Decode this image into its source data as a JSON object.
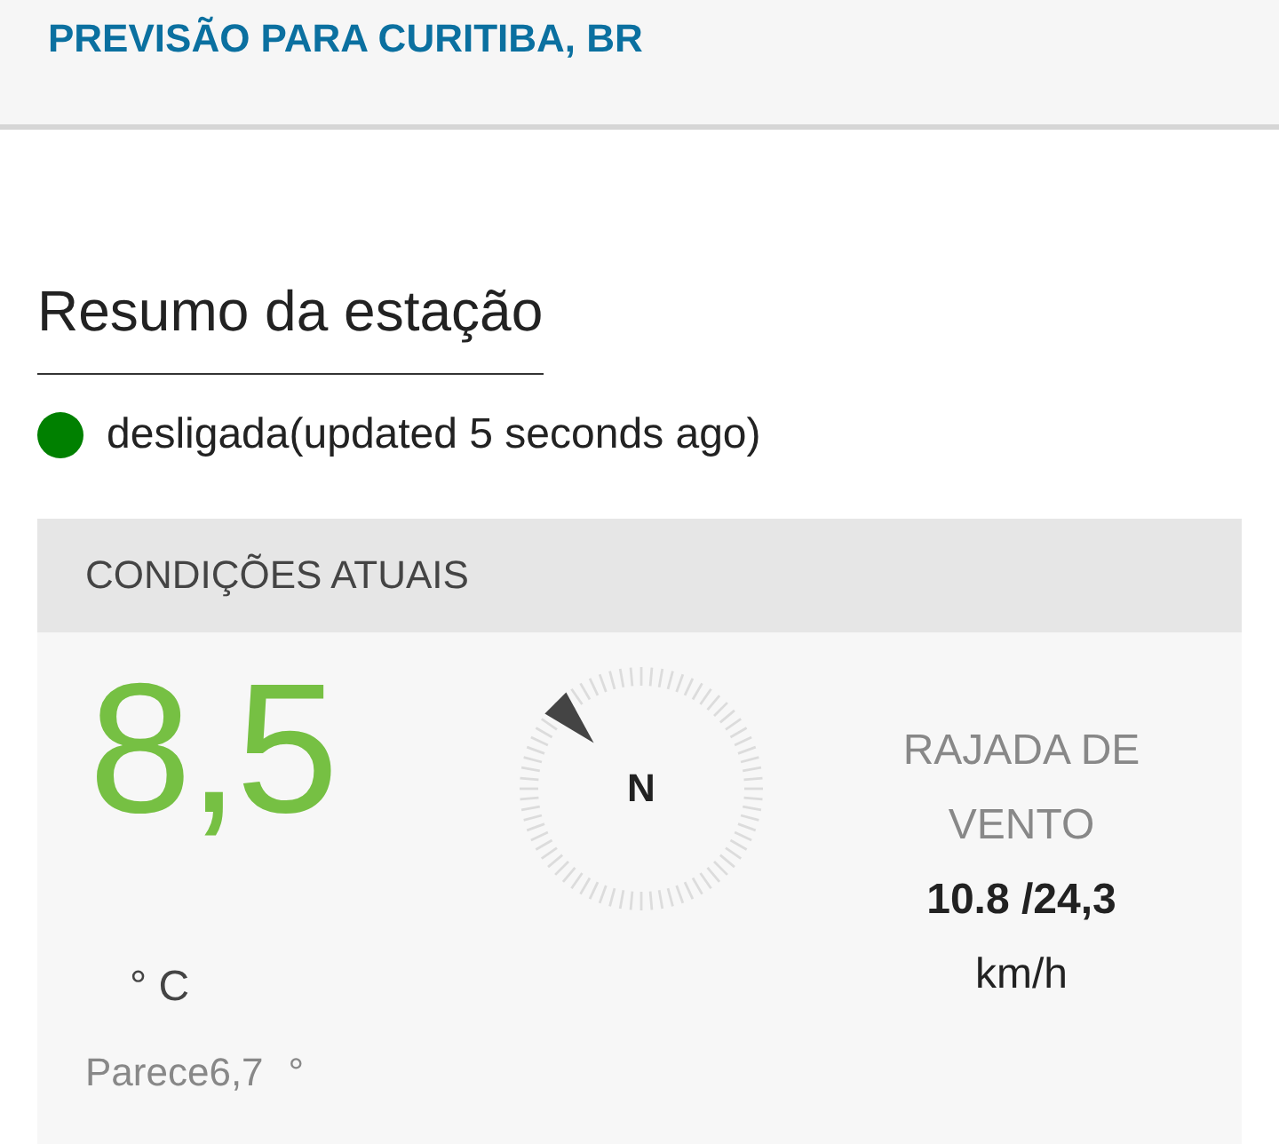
{
  "header": {
    "title": "PREVISÃO PARA CURITIBA, BR"
  },
  "station": {
    "title": "Resumo da estação",
    "status": {
      "text": "desligada(updated 5 seconds ago)",
      "color": "#008000"
    }
  },
  "current_conditions": {
    "title": "CONDIÇÕES ATUAIS",
    "temperature": {
      "value": "8,5",
      "unit": "° C",
      "feels_like": "Parece6,7",
      "feels_like_unit": "°"
    },
    "wind": {
      "compass_label": "N",
      "gust_label": "RAJADA DE VENTO",
      "gust_value": "10.8 /24,3",
      "gust_unit": "km/h"
    }
  }
}
